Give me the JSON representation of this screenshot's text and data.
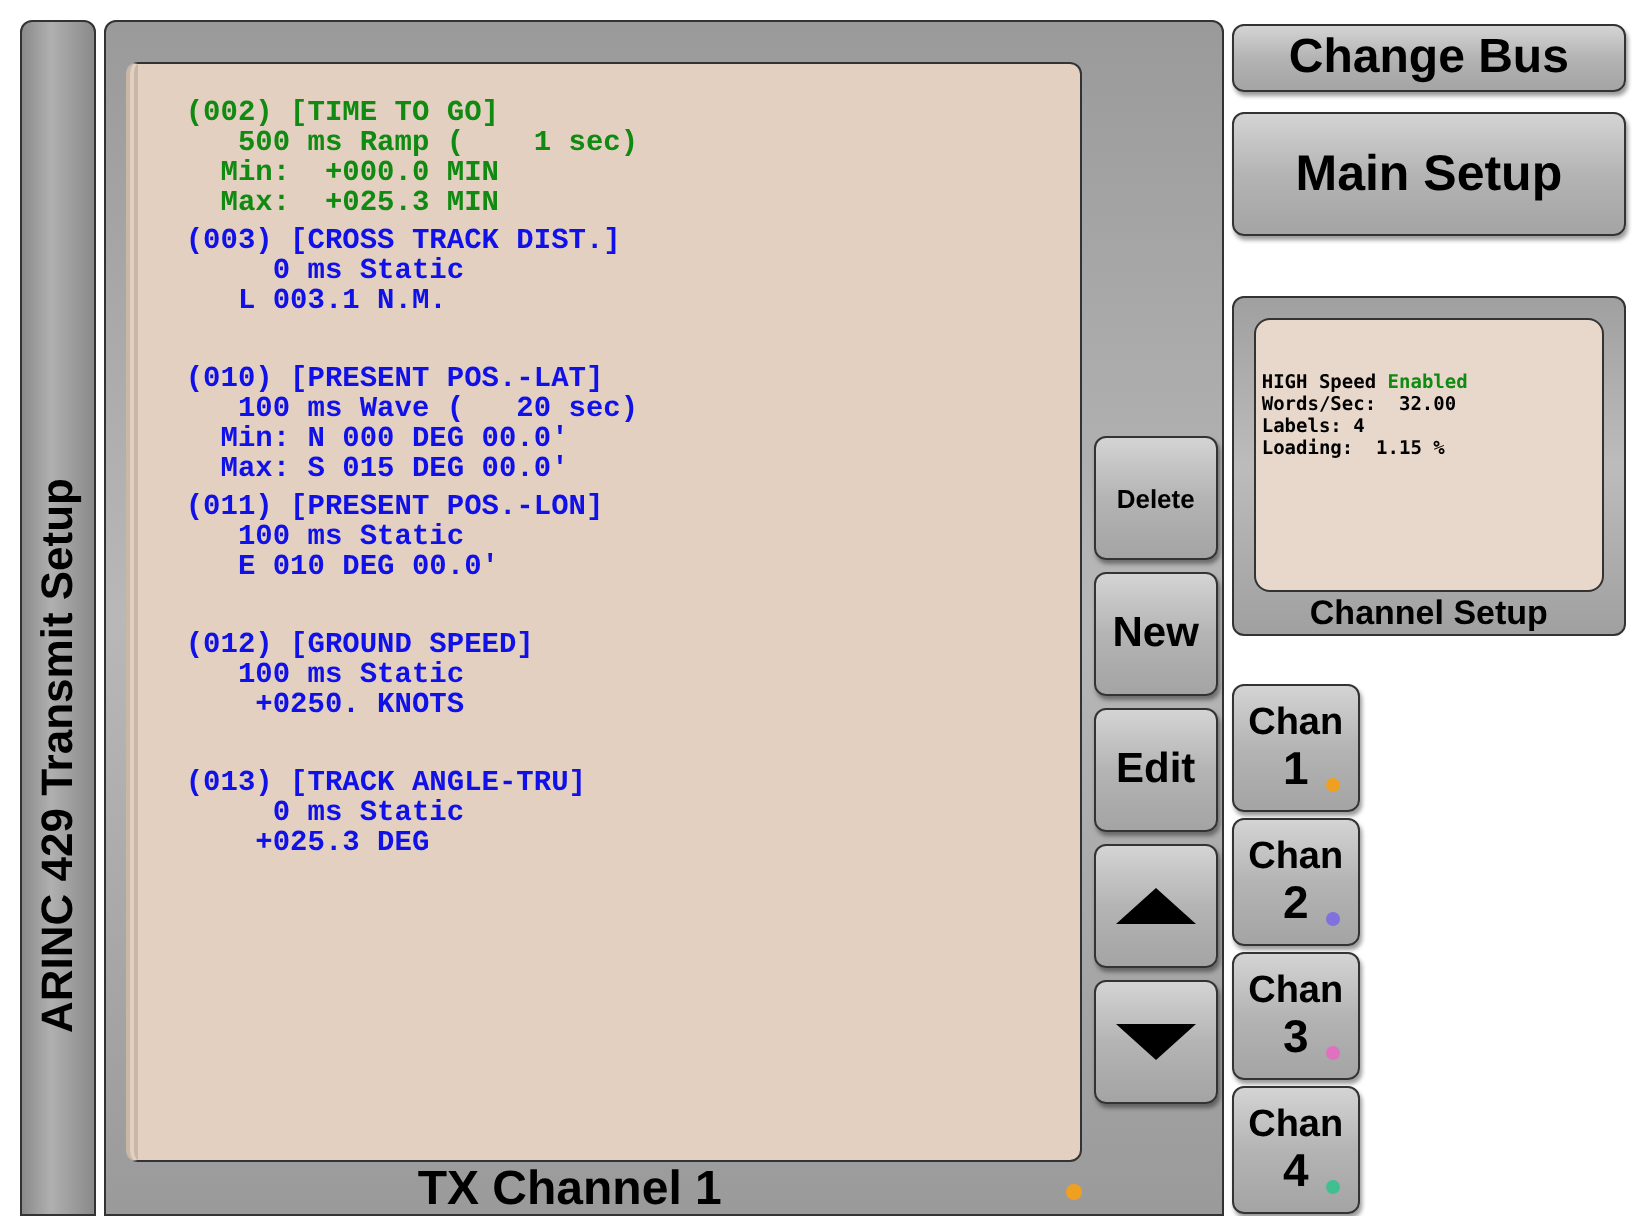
{
  "window": {
    "title": "ARINC 429 Transmit Setup"
  },
  "label_list": {
    "title": "TX Channel 1",
    "entries": [
      {
        "selected": true,
        "lines": [
          "(002) [TIME TO GO]",
          "   500 ms Ramp (    1 sec)",
          "  Min:  +000.0 MIN",
          "  Max:  +025.3 MIN"
        ]
      },
      {
        "selected": false,
        "lines": [
          "(003) [CROSS TRACK DIST.]",
          "     0 ms Static",
          "   L 003.1 N.M."
        ]
      },
      {
        "selected": false,
        "lines": [
          "(010) [PRESENT POS.-LAT]",
          "   100 ms Wave (   20 sec)",
          "  Min: N 000 DEG 00.0'",
          "  Max: S 015 DEG 00.0'"
        ]
      },
      {
        "selected": false,
        "lines": [
          "(011) [PRESENT POS.-LON]",
          "   100 ms Static",
          "   E 010 DEG 00.0'"
        ]
      },
      {
        "selected": false,
        "lines": [
          "(012) [GROUND SPEED]",
          "   100 ms Static",
          "    +0250. KNOTS"
        ]
      },
      {
        "selected": false,
        "lines": [
          "(013) [TRACK ANGLE-TRU]",
          "     0 ms Static",
          "    +025.3 DEG"
        ]
      }
    ]
  },
  "list_buttons": [
    {
      "kind": "text",
      "label": "Delete"
    },
    {
      "kind": "text",
      "label": "New"
    },
    {
      "kind": "text",
      "label": "Edit"
    },
    {
      "kind": "up"
    },
    {
      "kind": "down"
    }
  ],
  "change_bus": "Change Bus",
  "main_setup": "Main Setup",
  "channel_setup": {
    "title": "Channel Setup",
    "speed_label": "HIGH Speed",
    "speed_state": "Enabled",
    "lines": [
      "Words/Sec:  32.00",
      "Labels: 4",
      "Loading:  1.15 %"
    ]
  },
  "channels": [
    {
      "label": "Chan",
      "number": "1",
      "color": "#f0a020"
    },
    {
      "label": "Chan",
      "number": "2",
      "color": "#8070e0"
    },
    {
      "label": "Chan",
      "number": "3",
      "color": "#e070c0"
    },
    {
      "label": "Chan",
      "number": "4",
      "color": "#40c090"
    }
  ]
}
